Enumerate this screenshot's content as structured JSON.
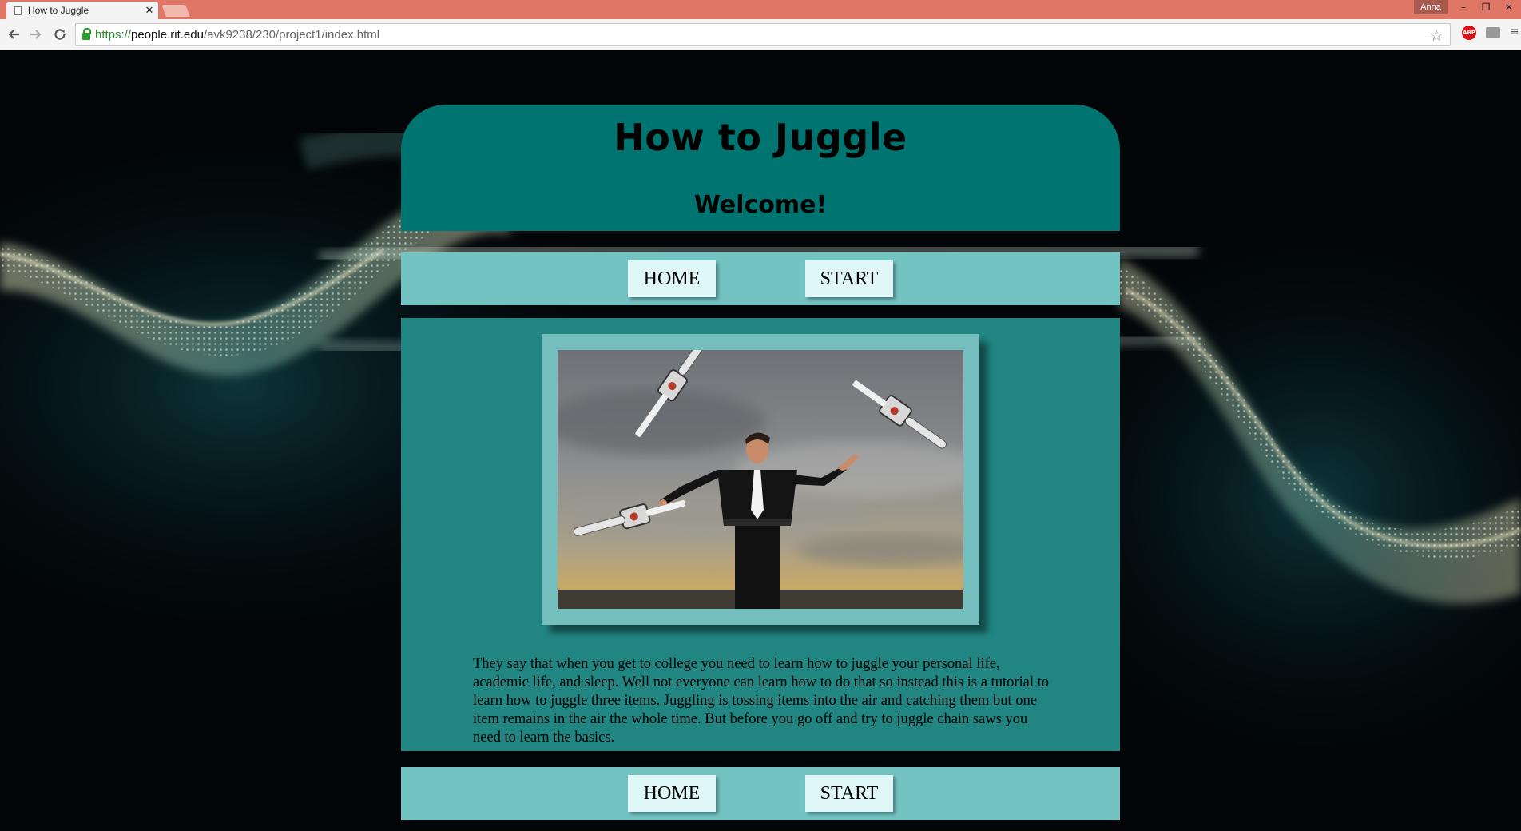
{
  "browser": {
    "tab_title": "How to Juggle",
    "tab_close": "✕",
    "profile_name": "Anna",
    "window_controls": {
      "minimize": "–",
      "maximize": "❐",
      "close": "✕"
    },
    "url": {
      "scheme": "https://",
      "host": "people.rit.edu",
      "path": "/avk9238/230/project1/index.html"
    },
    "icons": [
      "back-arrow-icon",
      "forward-arrow-icon",
      "reload-icon",
      "lock-icon",
      "star-icon",
      "adblock-icon",
      "camera-icon",
      "menu-icon"
    ],
    "extension_abp": "ABP"
  },
  "page": {
    "title": "How to Juggle",
    "subtitle": "Welcome!",
    "nav_top": {
      "home": "HOME",
      "start": "START"
    },
    "nav_bottom": {
      "home": "HOME",
      "start": "START"
    },
    "photo_alt": "man juggling chainsaws",
    "intro_text": "They say that when you get to college you need to learn how to juggle your personal life, academic life, and sleep. Well not everyone can learn how to do that so instead this is a tutorial to learn how to juggle three items. Juggling is tossing items into the air and catching them but one item remains in the air the whole time. But before you go off and try to juggle chain saws you need to learn the basics."
  },
  "colors": {
    "header": "#007470",
    "navbar": "#73c3c3",
    "nav_button": "#dff7f6",
    "content": "#218582",
    "photo_frame": "#74bebd",
    "titlebar": "#e07766"
  }
}
